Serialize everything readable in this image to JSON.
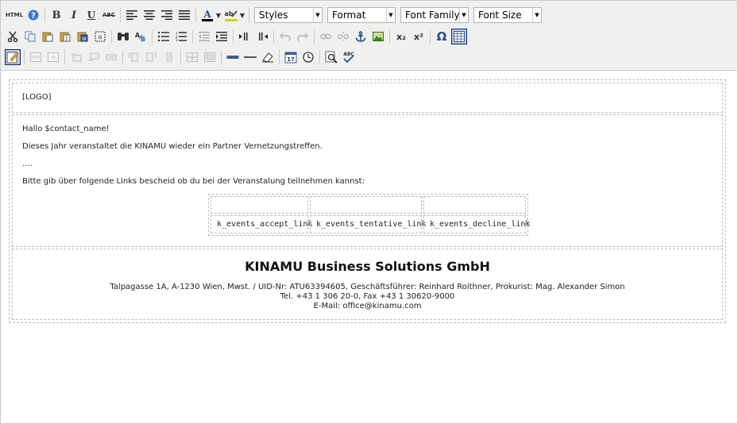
{
  "toolbar": {
    "row1": {
      "html_label": "HTML",
      "styles_select": "Styles",
      "format_select": "Format",
      "font_family_select": "Font Family",
      "font_size_select": "Font Size",
      "bold": "B",
      "italic": "I",
      "underline": "U",
      "strike": "ABC",
      "text_color": "A",
      "highlight": "ab"
    },
    "row2": {
      "subscript": "x₂",
      "superscript": "x²",
      "omega": "Ω"
    },
    "row3": {
      "spellcheck": "ABC",
      "date": "17"
    }
  },
  "document": {
    "logo_placeholder": "[LOGO]",
    "greeting": "Hallo $contact_name!",
    "paragraph1": "Dieses Jahr veranstaltet die KINAMU wieder ein Partner Vernetzungstreffen.",
    "ellipsis": "....",
    "paragraph2": "Bitte gib über folgende Links bescheid ob du bei der Veranstalung teilnehmen kannst:",
    "links": [
      "k_events_accept_link",
      "k_events_tentative_link",
      "k_events_decline_link"
    ],
    "footer": {
      "company": "KINAMU Business Solutions GmbH",
      "address": "Talpagasse 1A, A-1230 Wien, Mwst. / UID-Nr: ATU63394605, Geschäftsführer: Reinhard Roithner, Prokurist: Mag. Alexander Simon",
      "phone": "Tel. +43 1 306 20-0, Fax +43 1 30620-9000",
      "email": "E-Mail: office@kinamu.com"
    }
  }
}
